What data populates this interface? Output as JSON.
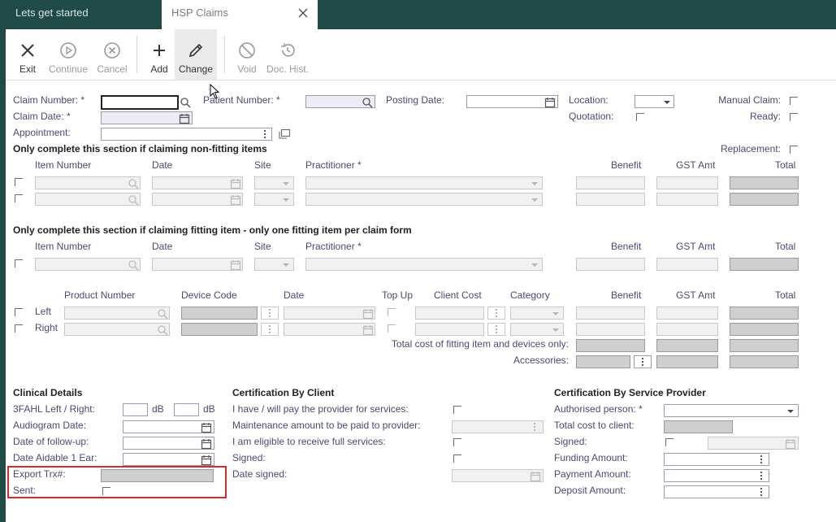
{
  "tabs": [
    {
      "label": "Lets get started"
    },
    {
      "label": "HSP Claims"
    }
  ],
  "toolbar": {
    "exit": "Exit",
    "continue": "Continue",
    "cancel": "Cancel",
    "add": "Add",
    "change": "Change",
    "void": "Void",
    "doc_hist": "Doc. Hist."
  },
  "header": {
    "claim_number": "Claim Number: *",
    "patient_number": "Patient Number: *",
    "posting_date": "Posting Date:",
    "location": "Location:",
    "manual_claim": "Manual Claim:",
    "claim_date": "Claim Date: *",
    "quotation": "Quotation:",
    "ready": "Ready:",
    "appointment": "Appointment:"
  },
  "non_fitting": {
    "title": "Only complete this section if claiming non-fitting items",
    "replacement": "Replacement:",
    "columns": {
      "item_number": "Item Number",
      "date": "Date",
      "site": "Site",
      "practitioner": "Practitioner *",
      "benefit": "Benefit",
      "gst_amt": "GST Amt",
      "total": "Total"
    }
  },
  "fitting": {
    "title": "Only complete this section if claiming fitting item - only one fitting item per claim form",
    "columns": {
      "item_number": "Item Number",
      "date": "Date",
      "site": "Site",
      "practitioner": "Practitioner *",
      "benefit": "Benefit",
      "gst_amt": "GST Amt",
      "total": "Total"
    }
  },
  "devices": {
    "columns": {
      "product_number": "Product Number",
      "device_code": "Device Code",
      "date": "Date",
      "top_up": "Top Up",
      "client_cost": "Client Cost",
      "category": "Category",
      "benefit": "Benefit",
      "gst_amt": "GST Amt",
      "total": "Total"
    },
    "left": "Left",
    "right": "Right",
    "total_cost": "Total cost of fitting item and devices only:",
    "accessories": "Accessories:"
  },
  "clinical": {
    "title": "Clinical Details",
    "fahl": "3FAHL Left / Right:",
    "db": "dB",
    "audiogram": "Audiogram Date:",
    "followup": "Date of follow-up:",
    "aidable": "Date Aidable 1 Ear:",
    "export": "Export Trx#:",
    "sent": "Sent:"
  },
  "cert_client": {
    "title": "Certification By Client",
    "pay": "I have / will pay the provider for services:",
    "maintenance": "Maintenance amount to be paid to provider:",
    "eligible": "I am eligible to receive full services:",
    "signed": "Signed:",
    "date_signed": "Date signed:"
  },
  "cert_provider": {
    "title": "Certification By Service Provider",
    "authorised": "Authorised person: *",
    "total_cost": "Total cost to client:",
    "signed": "Signed:",
    "funding": "Funding Amount:",
    "payment": "Payment Amount:",
    "deposit": "Deposit Amount:"
  }
}
